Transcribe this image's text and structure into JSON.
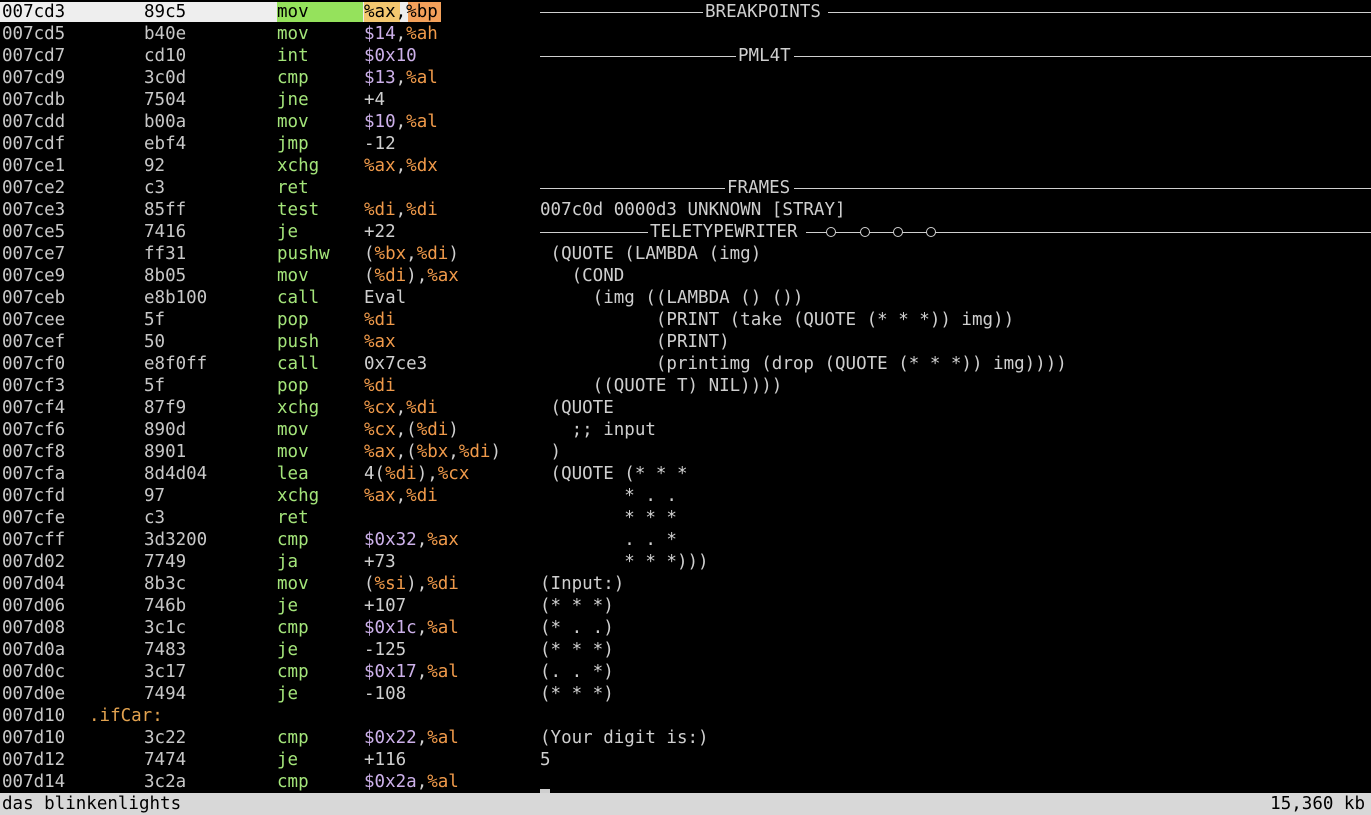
{
  "disassembly": [
    {
      "addr": "007cd3",
      "hex": "89c5",
      "mnemonic": "mov",
      "ops": [
        [
          "%ax",
          "reg"
        ],
        [
          ",",
          "plain"
        ],
        [
          "%bp",
          "reg"
        ]
      ]
    },
    {
      "addr": "007cd5",
      "hex": "b40e",
      "mnemonic": "mov",
      "ops": [
        [
          "$14",
          "num"
        ],
        [
          ",",
          "plain"
        ],
        [
          "%ah",
          "reg"
        ]
      ]
    },
    {
      "addr": "007cd7",
      "hex": "cd10",
      "mnemonic": "int",
      "ops": [
        [
          "$0x10",
          "num"
        ]
      ]
    },
    {
      "addr": "007cd9",
      "hex": "3c0d",
      "mnemonic": "cmp",
      "ops": [
        [
          "$13",
          "num"
        ],
        [
          ",",
          "plain"
        ],
        [
          "%al",
          "reg"
        ]
      ]
    },
    {
      "addr": "007cdb",
      "hex": "7504",
      "mnemonic": "jne",
      "ops": [
        [
          "+4",
          "plain"
        ]
      ]
    },
    {
      "addr": "007cdd",
      "hex": "b00a",
      "mnemonic": "mov",
      "ops": [
        [
          "$10",
          "num"
        ],
        [
          ",",
          "plain"
        ],
        [
          "%al",
          "reg"
        ]
      ]
    },
    {
      "addr": "007cdf",
      "hex": "ebf4",
      "mnemonic": "jmp",
      "ops": [
        [
          "-12",
          "plain"
        ]
      ]
    },
    {
      "addr": "007ce1",
      "hex": "92",
      "mnemonic": "xchg",
      "ops": [
        [
          "%ax",
          "reg"
        ],
        [
          ",",
          "plain"
        ],
        [
          "%dx",
          "reg"
        ]
      ]
    },
    {
      "addr": "007ce2",
      "hex": "c3",
      "mnemonic": "ret",
      "ops": []
    },
    {
      "addr": "007ce3",
      "hex": "85ff",
      "mnemonic": "test",
      "ops": [
        [
          "%di",
          "reg"
        ],
        [
          ",",
          "plain"
        ],
        [
          "%di",
          "reg"
        ]
      ]
    },
    {
      "addr": "007ce5",
      "hex": "7416",
      "mnemonic": "je",
      "ops": [
        [
          "+22",
          "plain"
        ]
      ]
    },
    {
      "addr": "007ce7",
      "hex": "ff31",
      "mnemonic": "pushw",
      "ops": [
        [
          "(",
          "plain"
        ],
        [
          "%bx",
          "reg"
        ],
        [
          ",",
          "plain"
        ],
        [
          "%di",
          "reg"
        ],
        [
          ")",
          "plain"
        ]
      ]
    },
    {
      "addr": "007ce9",
      "hex": "8b05",
      "mnemonic": "mov",
      "ops": [
        [
          "(",
          "plain"
        ],
        [
          "%di",
          "reg"
        ],
        [
          "),",
          "plain"
        ],
        [
          "%ax",
          "reg"
        ]
      ]
    },
    {
      "addr": "007ceb",
      "hex": "e8b100",
      "mnemonic": "call",
      "ops": [
        [
          "Eval",
          "plain"
        ]
      ]
    },
    {
      "addr": "007cee",
      "hex": "5f",
      "mnemonic": "pop",
      "ops": [
        [
          "%di",
          "reg"
        ]
      ]
    },
    {
      "addr": "007cef",
      "hex": "50",
      "mnemonic": "push",
      "ops": [
        [
          "%ax",
          "reg"
        ]
      ]
    },
    {
      "addr": "007cf0",
      "hex": "e8f0ff",
      "mnemonic": "call",
      "ops": [
        [
          "0x7ce3",
          "plain"
        ]
      ]
    },
    {
      "addr": "007cf3",
      "hex": "5f",
      "mnemonic": "pop",
      "ops": [
        [
          "%di",
          "reg"
        ]
      ]
    },
    {
      "addr": "007cf4",
      "hex": "87f9",
      "mnemonic": "xchg",
      "ops": [
        [
          "%cx",
          "reg"
        ],
        [
          ",",
          "plain"
        ],
        [
          "%di",
          "reg"
        ]
      ]
    },
    {
      "addr": "007cf6",
      "hex": "890d",
      "mnemonic": "mov",
      "ops": [
        [
          "%cx",
          "reg"
        ],
        [
          ",(",
          "plain"
        ],
        [
          "%di",
          "reg"
        ],
        [
          ")",
          "plain"
        ]
      ]
    },
    {
      "addr": "007cf8",
      "hex": "8901",
      "mnemonic": "mov",
      "ops": [
        [
          "%ax",
          "reg"
        ],
        [
          ",(",
          "plain"
        ],
        [
          "%bx",
          "reg"
        ],
        [
          ",",
          "plain"
        ],
        [
          "%di",
          "reg"
        ],
        [
          ")",
          "plain"
        ]
      ]
    },
    {
      "addr": "007cfa",
      "hex": "8d4d04",
      "mnemonic": "lea",
      "ops": [
        [
          "4(",
          "plain"
        ],
        [
          "%di",
          "reg"
        ],
        [
          "),",
          "plain"
        ],
        [
          "%cx",
          "reg"
        ]
      ]
    },
    {
      "addr": "007cfd",
      "hex": "97",
      "mnemonic": "xchg",
      "ops": [
        [
          "%ax",
          "reg"
        ],
        [
          ",",
          "plain"
        ],
        [
          "%di",
          "reg"
        ]
      ]
    },
    {
      "addr": "007cfe",
      "hex": "c3",
      "mnemonic": "ret",
      "ops": []
    },
    {
      "addr": "007cff",
      "hex": "3d3200",
      "mnemonic": "cmp",
      "ops": [
        [
          "$0x32",
          "num"
        ],
        [
          ",",
          "plain"
        ],
        [
          "%ax",
          "reg"
        ]
      ]
    },
    {
      "addr": "007d02",
      "hex": "7749",
      "mnemonic": "ja",
      "ops": [
        [
          "+73",
          "plain"
        ]
      ]
    },
    {
      "addr": "007d04",
      "hex": "8b3c",
      "mnemonic": "mov",
      "ops": [
        [
          "(",
          "plain"
        ],
        [
          "%si",
          "reg"
        ],
        [
          "),",
          "plain"
        ],
        [
          "%di",
          "reg"
        ]
      ]
    },
    {
      "addr": "007d06",
      "hex": "746b",
      "mnemonic": "je",
      "ops": [
        [
          "+107",
          "plain"
        ]
      ]
    },
    {
      "addr": "007d08",
      "hex": "3c1c",
      "mnemonic": "cmp",
      "ops": [
        [
          "$0x1c",
          "num"
        ],
        [
          ",",
          "plain"
        ],
        [
          "%al",
          "reg"
        ]
      ]
    },
    {
      "addr": "007d0a",
      "hex": "7483",
      "mnemonic": "je",
      "ops": [
        [
          "-125",
          "plain"
        ]
      ]
    },
    {
      "addr": "007d0c",
      "hex": "3c17",
      "mnemonic": "cmp",
      "ops": [
        [
          "$0x17",
          "num"
        ],
        [
          ",",
          "plain"
        ],
        [
          "%al",
          "reg"
        ]
      ]
    },
    {
      "addr": "007d0e",
      "hex": "7494",
      "mnemonic": "je",
      "ops": [
        [
          "-108",
          "plain"
        ]
      ]
    },
    {
      "addr": "007d10",
      "label": ".ifCar:"
    },
    {
      "addr": "007d10",
      "hex": "3c22",
      "mnemonic": "cmp",
      "ops": [
        [
          "$0x22",
          "num"
        ],
        [
          ",",
          "plain"
        ],
        [
          "%al",
          "reg"
        ]
      ]
    },
    {
      "addr": "007d12",
      "hex": "7474",
      "mnemonic": "je",
      "ops": [
        [
          "+116",
          "plain"
        ]
      ]
    },
    {
      "addr": "007d14",
      "hex": "3c2a",
      "mnemonic": "cmp",
      "ops": [
        [
          "$0x2a",
          "num"
        ],
        [
          ",",
          "plain"
        ],
        [
          "%al",
          "reg"
        ]
      ]
    }
  ],
  "panels": {
    "breakpoints_title": "BREAKPOINTS",
    "pml4t_title": "PML4T",
    "frames_title": "FRAMES",
    "frames_line": "007c0d 0000d3 UNKNOWN [STRAY]",
    "teletype_title": "TELETYPEWRITER"
  },
  "teletype_lines": [
    " (QUOTE (LAMBDA (img)",
    "   (COND",
    "     (img ((LAMBDA () ())",
    "           (PRINT (take (QUOTE (* * *)) img))",
    "           (PRINT)",
    "           (printimg (drop (QUOTE (* * *)) img))))",
    "     ((QUOTE T) NIL))))",
    " (QUOTE",
    "   ;; input",
    " )",
    " (QUOTE (* * *",
    "        * . .",
    "        * * *",
    "        . . *",
    "        * * *)))",
    "(Input:)",
    "(* * *)",
    "(* . .)",
    "(* * *)",
    "(. . *)",
    "(* * *)",
    "",
    "(Your digit is:)",
    "5"
  ],
  "status": {
    "left": "das blinkenlights",
    "right": "15,360 kb"
  }
}
